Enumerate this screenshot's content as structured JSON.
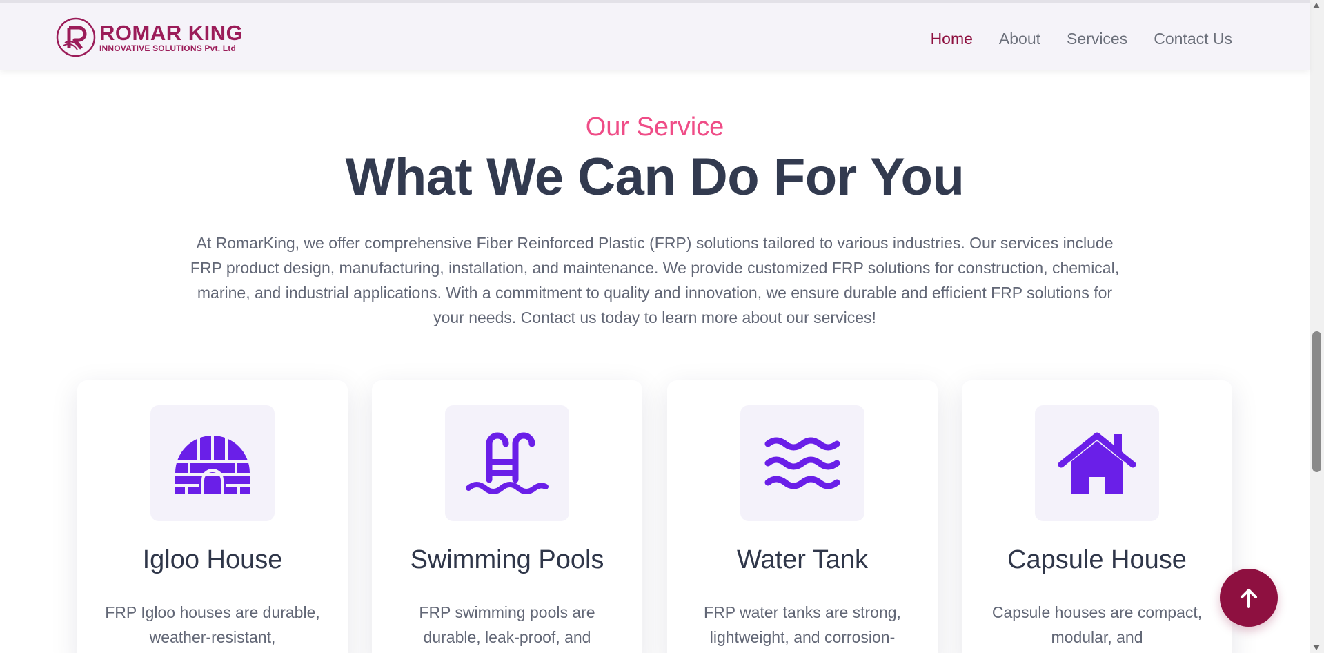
{
  "brand": {
    "name": "ROMAR KING",
    "subtitle": "INNOVATIVE SOLUTIONS Pvt. Ltd",
    "color": "#9b1c59"
  },
  "nav": {
    "items": [
      {
        "label": "Home",
        "active": true
      },
      {
        "label": "About",
        "active": false
      },
      {
        "label": "Services",
        "active": false
      },
      {
        "label": "Contact Us",
        "active": false
      }
    ]
  },
  "section": {
    "kicker": "Our Service",
    "title": "What We Can Do For You",
    "description": "At RomarKing, we offer comprehensive Fiber Reinforced Plastic (FRP) solutions tailored to various industries. Our services include FRP product design, manufacturing, installation, and maintenance. We provide customized FRP solutions for construction, chemical, marine, and industrial applications. With a commitment to quality and innovation, we ensure durable and efficient FRP solutions for your needs. Contact us today to learn more about our services!"
  },
  "services": [
    {
      "icon": "igloo-icon",
      "title": "Igloo House",
      "text": "FRP Igloo houses are durable, weather-resistant,"
    },
    {
      "icon": "swimming-pool-icon",
      "title": "Swimming Pools",
      "text": "FRP swimming pools are durable, leak-proof, and"
    },
    {
      "icon": "water-icon",
      "title": "Water Tank",
      "text": "FRP water tanks are strong, lightweight, and corrosion-"
    },
    {
      "icon": "house-icon",
      "title": "Capsule House",
      "text": "Capsule houses are compact, modular, and"
    }
  ],
  "colors": {
    "accent": "#ef4d87",
    "primary": "#8e1040",
    "icon": "#6a1fe8",
    "heading": "#323a4f"
  },
  "back_to_top": {
    "icon": "arrow-up-icon"
  }
}
